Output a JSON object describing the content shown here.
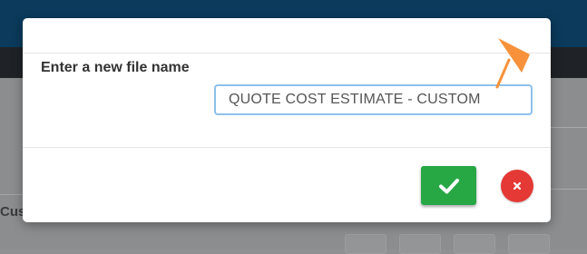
{
  "dialog": {
    "prompt_label": "Enter a new file name",
    "filename_value": "QUOTE COST ESTIMATE - CUSTOM",
    "confirm_icon": "checkmark-icon",
    "cancel_icon": "close-icon"
  },
  "background": {
    "partial_text": "Custon"
  },
  "colors": {
    "confirm": "#28a745",
    "cancel": "#e53935",
    "input_focus_border": "#8fc0ea",
    "annotation_arrow": "#f7923a"
  }
}
